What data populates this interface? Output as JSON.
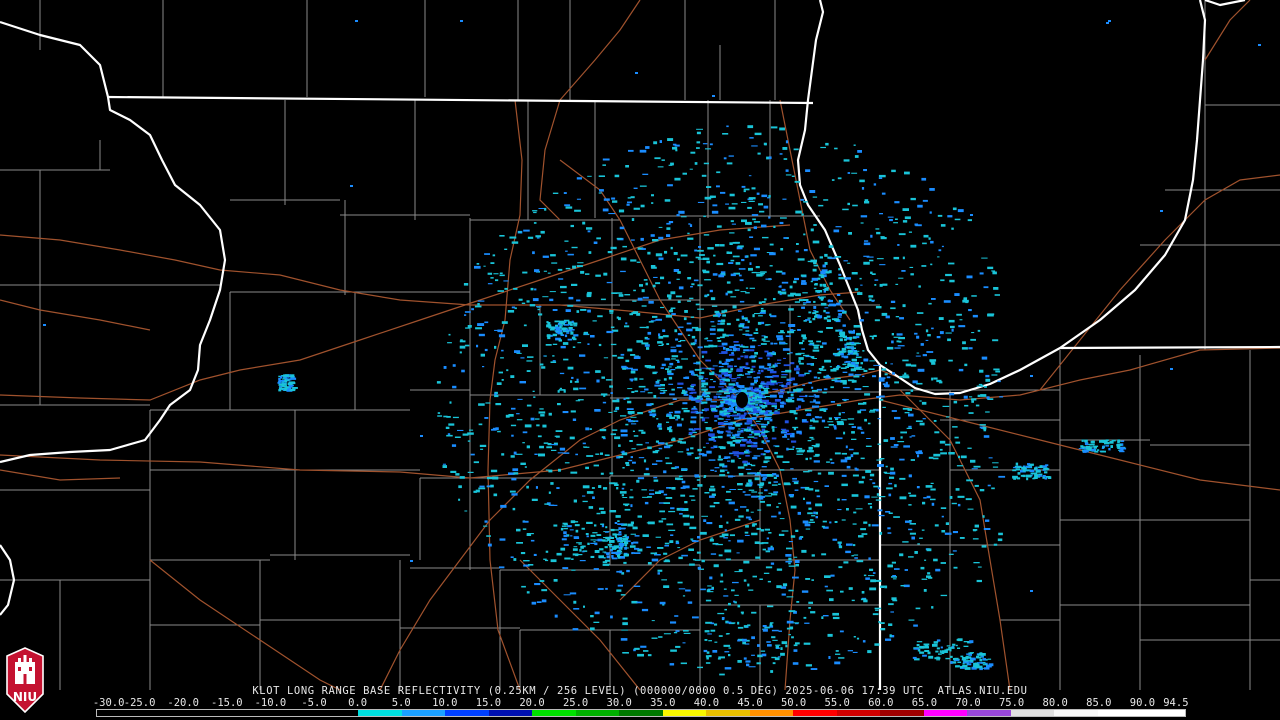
{
  "caption": "KLOT LONG RANGE BASE REFLECTIVITY (0.25KM / 256 LEVEL) (000000/0000 0.5 DEG) 2025-06-06 17:39 UTC  ATLAS.NIU.EDU",
  "logo_text": "NIU",
  "scale": {
    "labels": [
      "-30.0",
      "-25.0",
      "-20.0",
      "-15.0",
      "-10.0",
      "-5.0",
      "0.0",
      "5.0",
      "10.0",
      "15.0",
      "20.0",
      "25.0",
      "30.0",
      "35.0",
      "40.0",
      "45.0",
      "50.0",
      "55.0",
      "60.0",
      "65.0",
      "70.0",
      "75.0",
      "80.0",
      "85.0",
      "90.0",
      "94.5"
    ],
    "colors": [
      "#000000",
      "#000000",
      "#000000",
      "#000000",
      "#000000",
      "#000000",
      "#00e0e0",
      "#1aa0ff",
      "#0040ff",
      "#0010b0",
      "#00e000",
      "#00b000",
      "#007800",
      "#f8f800",
      "#e8c000",
      "#ff9000",
      "#ff0000",
      "#d00000",
      "#a00000",
      "#ff00ff",
      "#9848d8",
      "#e0e0e0",
      "#f8f8f8",
      "#ffffff",
      "#ffffff"
    ]
  },
  "colors": {
    "state_border": "#ffffff",
    "county_line": "#8a8a8a",
    "highway": "#a0522d",
    "echo_light": "#19c4d8",
    "echo_mid": "#1a8cff",
    "echo_dark": "#2050e0",
    "logo_red": "#c41230"
  }
}
